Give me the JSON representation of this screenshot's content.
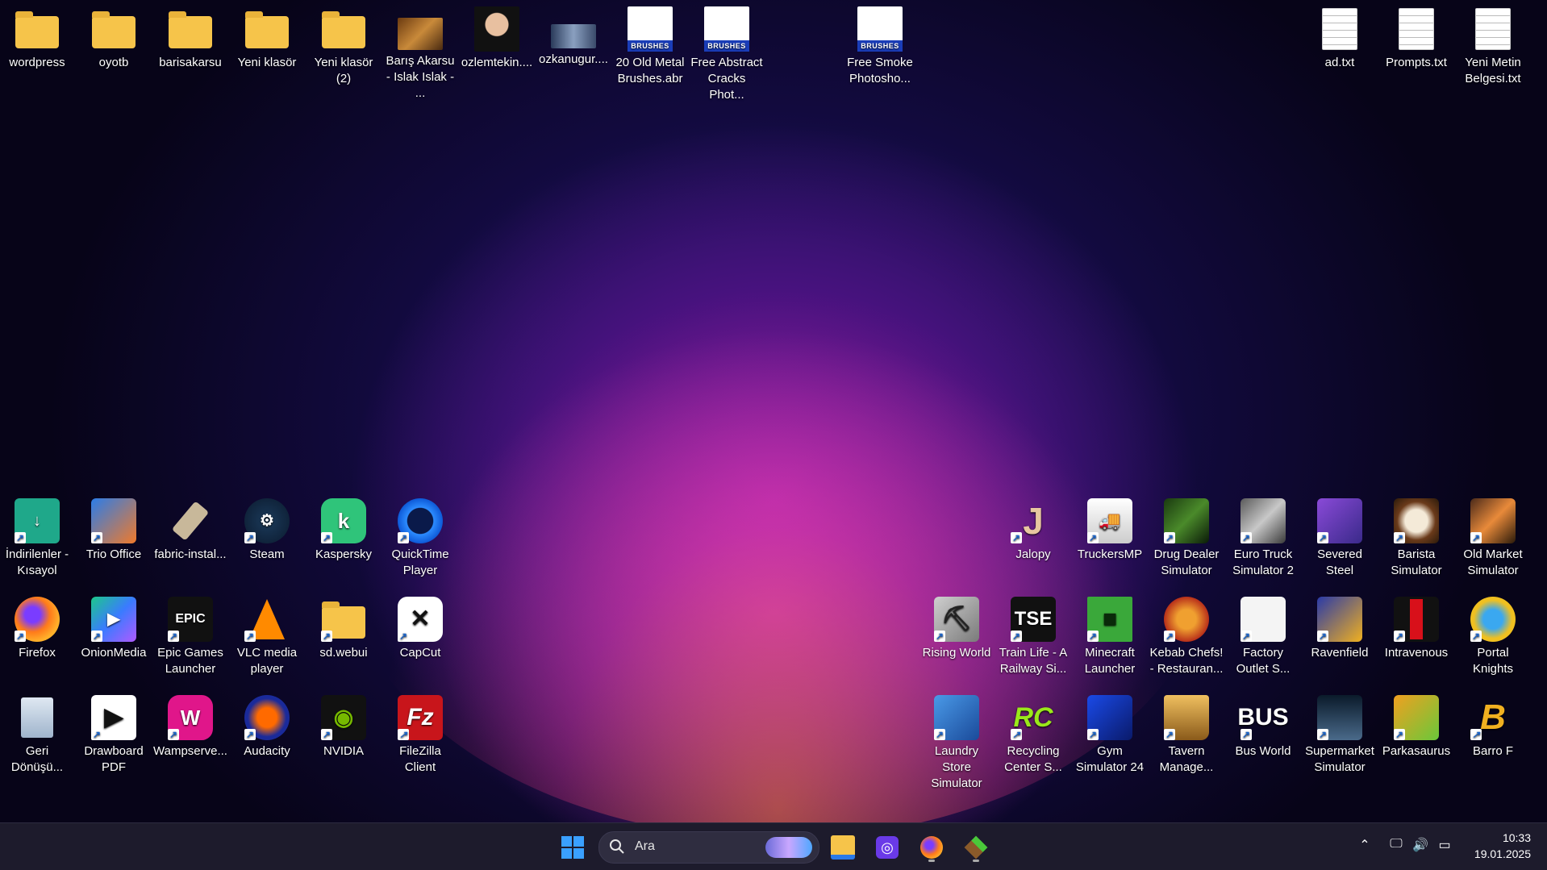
{
  "desktop_top_left": [
    {
      "label": "wordpress"
    },
    {
      "label": "oyotb"
    },
    {
      "label": "barisakarsu"
    },
    {
      "label": "Yeni klasör"
    },
    {
      "label": "Yeni klasör (2)"
    },
    {
      "label": "Barış Akarsu - Islak Islak - ..."
    },
    {
      "label": "ozlemtekin...."
    },
    {
      "label": "ozkanugur...."
    },
    {
      "label": "20 Old Metal Brushes.abr"
    },
    {
      "label": "Free Abstract Cracks Phot..."
    },
    {
      "label": "Free Smoke Photosho..."
    }
  ],
  "desktop_top_right": [
    {
      "label": "ad.txt"
    },
    {
      "label": "Prompts.txt"
    },
    {
      "label": "Yeni Metin Belgesi.txt"
    }
  ],
  "brush_badge": "BRUSHES",
  "desktop_bottom_left": [
    {
      "label": "İndirilenler - Kısayol"
    },
    {
      "label": "Trio Office"
    },
    {
      "label": "fabric-instal..."
    },
    {
      "label": "Steam"
    },
    {
      "label": "Kaspersky"
    },
    {
      "label": "QuickTime Player"
    },
    {
      "label": "Firefox"
    },
    {
      "label": "OnionMedia"
    },
    {
      "label": "Epic Games Launcher"
    },
    {
      "label": "VLC media player"
    },
    {
      "label": "sd.webui"
    },
    {
      "label": "CapCut"
    },
    {
      "label": "Geri Dönüşü..."
    },
    {
      "label": "Drawboard PDF"
    },
    {
      "label": "Wampserve..."
    },
    {
      "label": "Audacity"
    },
    {
      "label": "NVIDIA"
    },
    {
      "label": "FileZilla Client"
    }
  ],
  "desktop_bottom_right": [
    {
      "label": "Jalopy"
    },
    {
      "label": "TruckersMP"
    },
    {
      "label": "Drug Dealer Simulator"
    },
    {
      "label": "Euro Truck Simulator 2"
    },
    {
      "label": "Severed Steel"
    },
    {
      "label": "Barista Simulator"
    },
    {
      "label": "Old Market Simulator"
    },
    {
      "label": "Rising World"
    },
    {
      "label": "Train Life - A Railway Si..."
    },
    {
      "label": "Minecraft Launcher"
    },
    {
      "label": "Kebab Chefs! - Restauran..."
    },
    {
      "label": "Factory Outlet S..."
    },
    {
      "label": "Ravenfield"
    },
    {
      "label": "Intravenous"
    },
    {
      "label": "Portal Knights"
    },
    {
      "label": "Laundry Store Simulator"
    },
    {
      "label": "Recycling Center S..."
    },
    {
      "label": "Gym Simulator 24"
    },
    {
      "label": "Tavern Manage..."
    },
    {
      "label": "Bus World"
    },
    {
      "label": "Supermarket Simulator"
    },
    {
      "label": "Parkasaurus"
    },
    {
      "label": "Barro F"
    }
  ],
  "icon_text": {
    "tse": "TSE",
    "rc": "RC",
    "bus": "BUS",
    "epic": "EPIC",
    "k": "k"
  },
  "taskbar": {
    "search_placeholder": "Ara",
    "time": "10:33",
    "date": "19.01.2025"
  }
}
